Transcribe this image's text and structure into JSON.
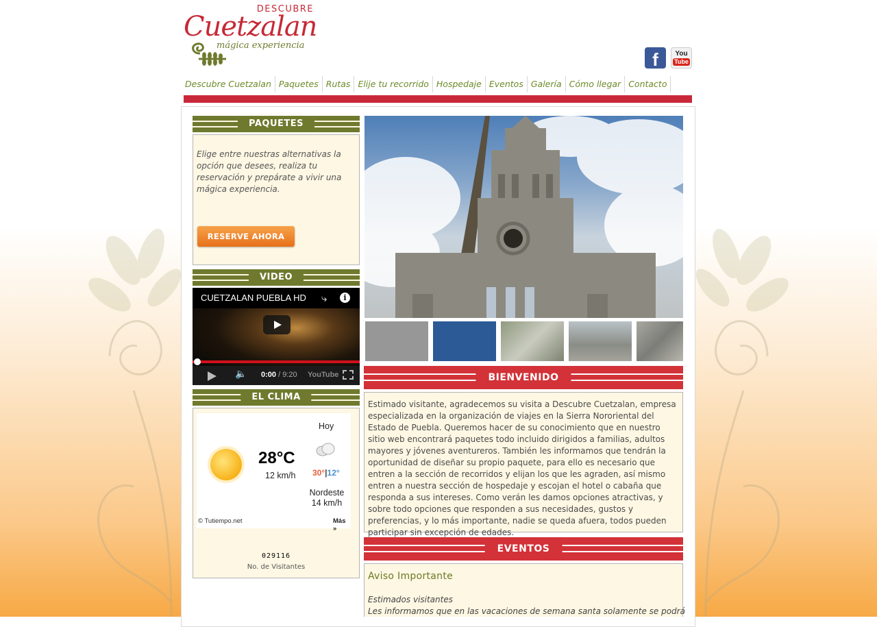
{
  "logo": {
    "descubre": "DESCUBRE",
    "brand": "Cuetzalan",
    "tagline": "mágica experiencia"
  },
  "social": {
    "facebook": "f",
    "youtube_top": "You",
    "youtube_bottom": "Tube"
  },
  "nav": [
    "Descubre Cuetzalan",
    "Paquetes",
    "Rutas",
    "Elije tu recorrido",
    "Hospedaje",
    "Eventos",
    "Galería",
    "Cómo llegar",
    "Contacto"
  ],
  "paquetes": {
    "heading": "PAQUETES",
    "text": "Elige entre nuestras alternativas la opción que desees, realiza tu reservación y prepárate a vivir una mágica experiencia.",
    "button": "RESERVE AHORA"
  },
  "video": {
    "heading": "VIDEO",
    "title": "CUETZALAN PUEBLA HD",
    "time_current": "0:00",
    "time_total": "/ 9:20",
    "brand": "YouTube",
    "progress": 0
  },
  "clima": {
    "heading": "EL CLIMA",
    "temp": "28°C",
    "speed": "12 km/h",
    "today": "Hoy",
    "high": "30°",
    "separator": "|",
    "low": "12°",
    "wind_dir": "Nordeste",
    "wind_speed": "14 km/h",
    "credit": "© Tutiempo.net",
    "more": "Más »",
    "counter": "029116",
    "counter_label": "No. de Visitantes"
  },
  "bienvenido": {
    "heading": "BIENVENIDO",
    "text": "Estimado visitante, agradecemos su visita a Descubre Cuetzalan, empresa especializada en la organización de viajes en la Sierra Nororiental del Estado de Puebla. Queremos hacer de su conocimiento que en nuestro sitio web encontrará paquetes todo incluido dirigidos a familias, adultos mayores y jóvenes aventureros. También les informamos que tendrán la oportunidad de diseñar su propio paquete, para ello es necesario que entren a la sección de recorridos y elijan los que les agraden, así mismo entren a nuestra sección de hospedaje y escojan el hotel o cabaña que responda a sus intereses. Como verán les damos opciones atractivas, y sobre todo opciones que responden a sus necesidades, gustos y preferencias, y lo más importante, nadie se queda afuera, todos pueden participar sin excepción de edades."
  },
  "eventos": {
    "heading": "EVENTOS",
    "aviso": "Aviso Importante",
    "line1": "Estimados visitantes",
    "line2": "Les informamos que en las vacaciones de semana santa solamente se podrá"
  },
  "colors": {
    "brand_red": "#c9283a",
    "olive": "#6f7a2e",
    "cream": "#fdf7e3",
    "nav_green": "#6b8a28"
  }
}
